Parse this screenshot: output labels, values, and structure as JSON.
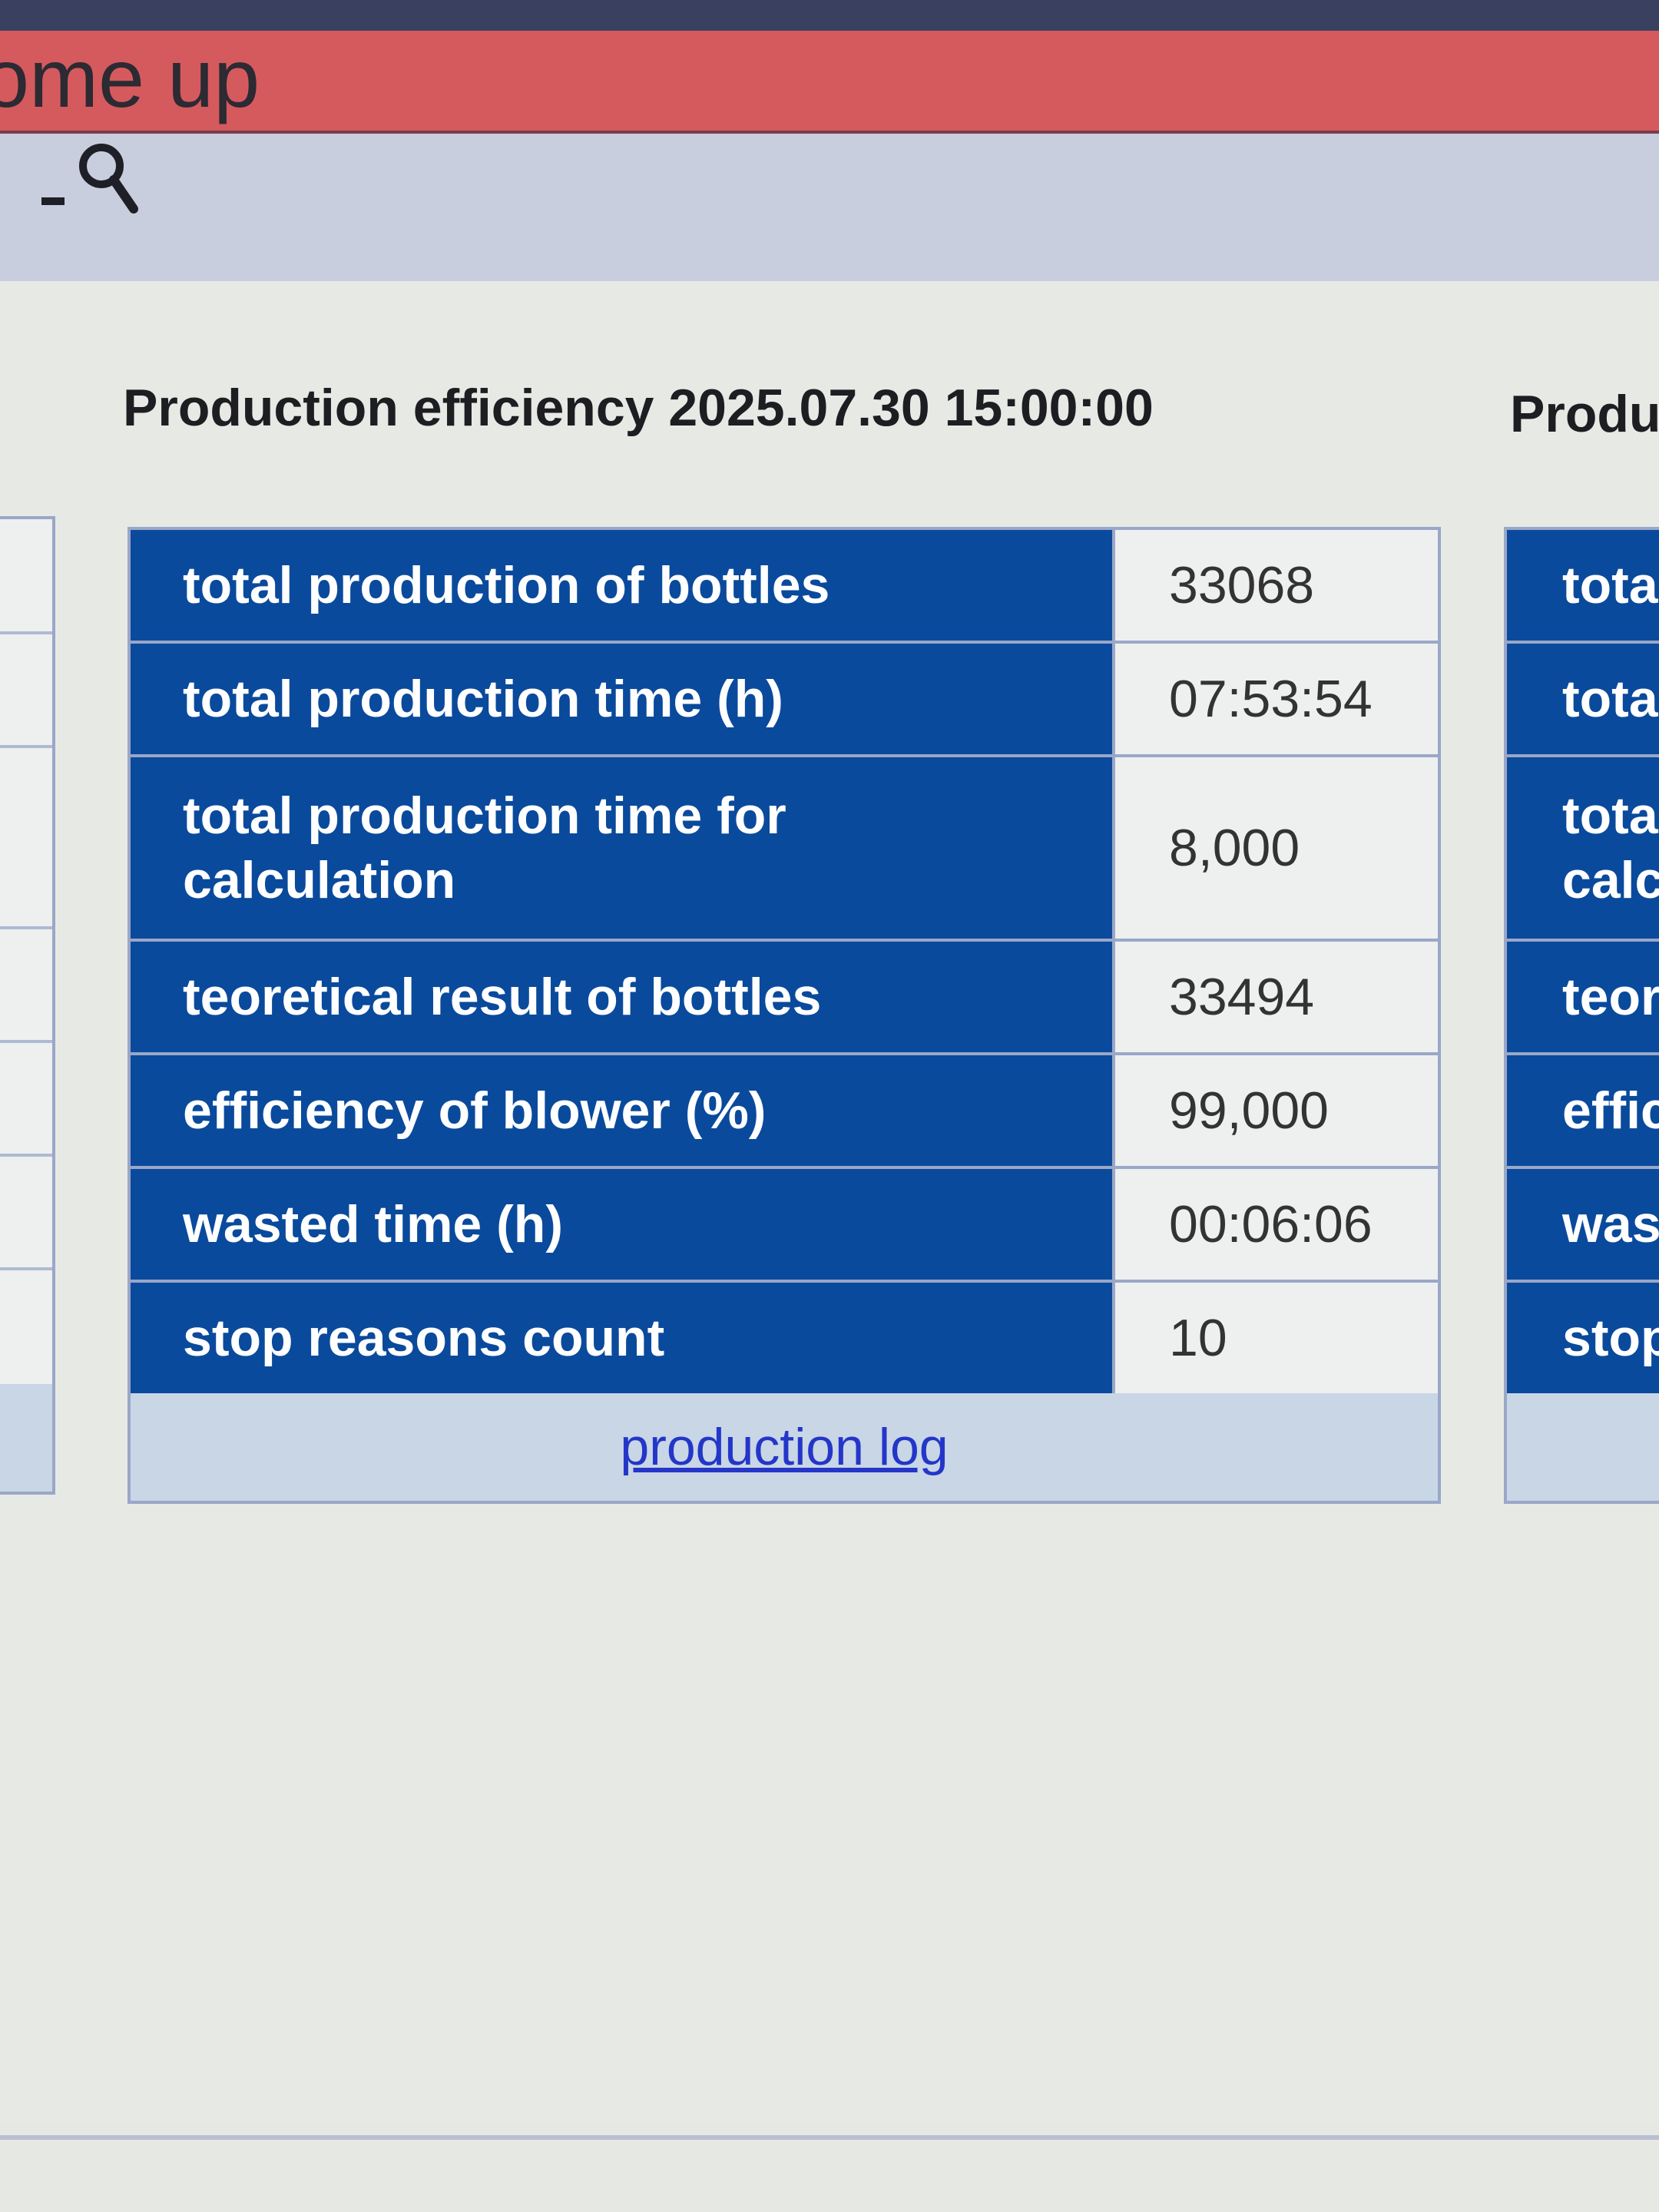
{
  "header": {
    "title": "ome up"
  },
  "toolbar": {
    "search_icon": "search-icon"
  },
  "panel": {
    "title": "Production efficiency 2025.07.30 15:00:00",
    "rows": [
      {
        "label": "total production of bottles",
        "value": "33068"
      },
      {
        "label": "total production time (h)",
        "value": "07:53:54"
      },
      {
        "label": "total production time for calculation",
        "value": "8,000"
      },
      {
        "label": "teoretical result of bottles",
        "value": "33494"
      },
      {
        "label": "efficiency of blower (%)",
        "value": "99,000"
      },
      {
        "label": "wasted time (h)",
        "value": "00:06:06"
      },
      {
        "label": "stop reasons count",
        "value": "10"
      }
    ],
    "footer_link": "production log"
  },
  "right_panel": {
    "title": "Produ",
    "rows": [
      {
        "label": "tota"
      },
      {
        "label": "tota"
      },
      {
        "label": "tota\ncalc"
      },
      {
        "label": "teor"
      },
      {
        "label": "effic"
      },
      {
        "label": "was"
      },
      {
        "label": "stop"
      }
    ]
  },
  "colors": {
    "header": "#d55a5e",
    "label_bg": "#0a4a9c",
    "value_bg": "#eef0ef",
    "link": "#2436c8"
  }
}
